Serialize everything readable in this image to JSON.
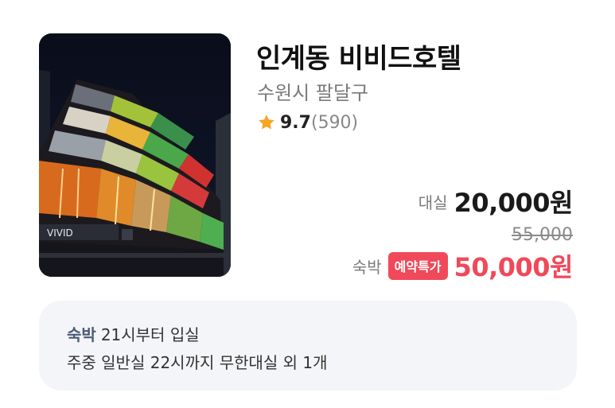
{
  "hotel": {
    "name": "인계동 비비드호텔",
    "location": "수원시 팔달구",
    "rating": "9.7",
    "review_count": "(590)",
    "rating_icon": "star-icon"
  },
  "pricing": {
    "rent_label": "대실",
    "rent_price": "20,000원",
    "original_price": "55,000",
    "stay_label": "숙박",
    "badge": "예약특가",
    "stay_price": "50,000원"
  },
  "info": {
    "tag": "숙박",
    "checkin": "21시부터 입실",
    "detail": "주중 일반실 22시까지 무한대실 외 1개"
  },
  "colors": {
    "accent_red": "#f0495a",
    "star": "#f5a623",
    "info_bg": "#f4f5f8",
    "info_tag": "#4b5a77"
  }
}
